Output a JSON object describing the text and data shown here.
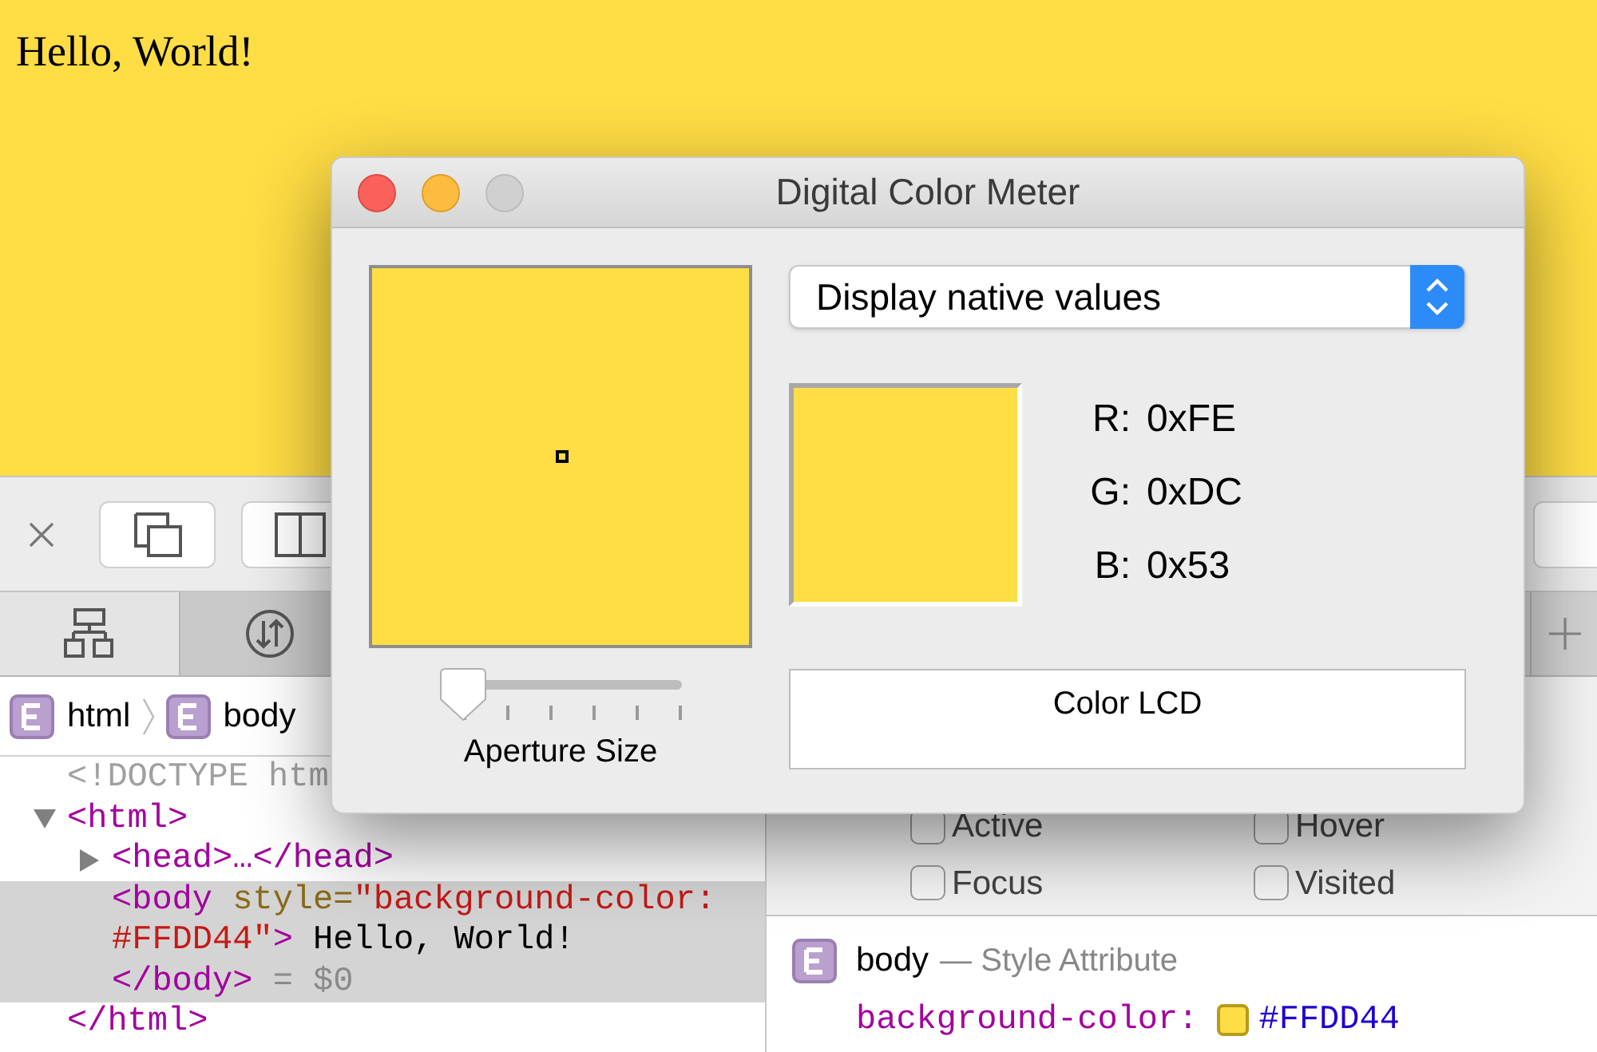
{
  "page": {
    "text": "Hello, World!"
  },
  "devtools": {
    "tabs": [
      {
        "kind": "elements",
        "selected": true
      },
      {
        "kind": "network",
        "selected": false
      }
    ],
    "breadcrumb": [
      "html",
      "body"
    ],
    "dom_tree": [
      {
        "kind": "doctype",
        "text": "<!DOCTYPE htm"
      },
      {
        "kind": "element",
        "expanded": true,
        "selected": false,
        "segments": [
          {
            "kind": "tag",
            "text": "<html>"
          }
        ],
        "children": [
          {
            "kind": "element",
            "expanded": false,
            "selected": false,
            "segments": [
              {
                "kind": "tag",
                "text": "<head>…</head>"
              }
            ]
          },
          {
            "kind": "leaf",
            "selected": true,
            "lines": [
              [
                {
                  "kind": "tag",
                  "text": "<body"
                },
                {
                  "kind": "attr",
                  "text": " style="
                },
                {
                  "kind": "value",
                  "text": "\"background-color:"
                }
              ],
              [
                {
                  "kind": "value",
                  "text": "#FFDD44\""
                },
                {
                  "kind": "tag",
                  "text": ">"
                },
                {
                  "kind": "text",
                  "text": " Hello, World!"
                }
              ],
              [
                {
                  "kind": "tag",
                  "text": "</body>"
                },
                {
                  "kind": "dim",
                  "text": " = $0"
                }
              ]
            ]
          }
        ]
      },
      {
        "kind": "close",
        "text": "</html>"
      }
    ],
    "pseudo_classes": [
      {
        "label": "Active",
        "checked": false
      },
      {
        "label": "Hover",
        "checked": false
      },
      {
        "label": "Focus",
        "checked": false
      },
      {
        "label": "Visited",
        "checked": false
      }
    ],
    "style_rule": {
      "selector": "body",
      "origin": "— Style Attribute",
      "property": "background-color:",
      "value": "#FFDD44"
    }
  },
  "color_meter": {
    "title": "Digital Color Meter",
    "mode": "Display native values",
    "readings": [
      {
        "label": "R:",
        "value": "0xFE"
      },
      {
        "label": "G:",
        "value": "0xDC"
      },
      {
        "label": "B:",
        "value": "0x53"
      }
    ],
    "aperture": {
      "label": "Aperture Size",
      "level": 0.0
    },
    "display": "Color LCD"
  }
}
